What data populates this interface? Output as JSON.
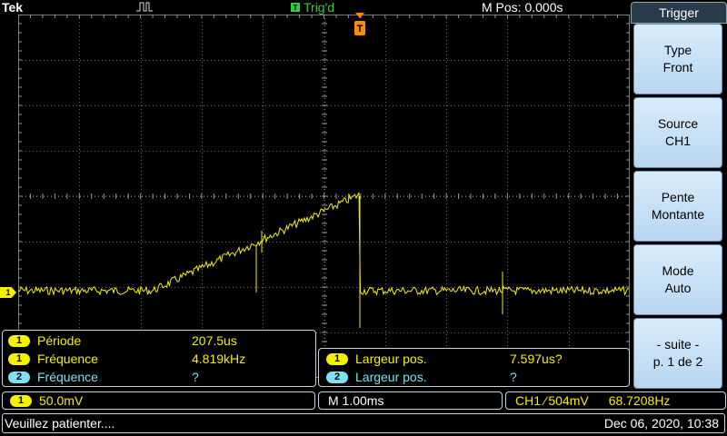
{
  "top": {
    "brand": "Tek",
    "trigger_state": "Trig'd",
    "position": "M Pos: 0.000s"
  },
  "menu": {
    "title": "Trigger",
    "buttons": [
      {
        "line1": "Type",
        "line2": "Front"
      },
      {
        "line1": "Source",
        "line2": "CH1"
      },
      {
        "line1": "Pente",
        "line2": "Montante"
      },
      {
        "line1": "Mode",
        "line2": "Auto"
      },
      {
        "line1": "- suite -",
        "line2": "p. 1 de 2"
      }
    ]
  },
  "measurements_left": [
    {
      "channel": "1",
      "label": "Période",
      "value": "207.5us"
    },
    {
      "channel": "1",
      "label": "Fréquence",
      "value": "4.819kHz"
    },
    {
      "channel": "2",
      "label": "Fréquence",
      "value": "?"
    }
  ],
  "measurements_right": [
    {
      "channel": "1",
      "label": "Largeur pos.",
      "value": "7.597us?"
    },
    {
      "channel": "2",
      "label": "Largeur pos.",
      "value": "?"
    }
  ],
  "status": {
    "ch1_channel": "1",
    "ch1_scale": "50.0mV",
    "timebase": "M 1.00ms",
    "trigger_source": "CH1",
    "trigger_slope": "⁄",
    "trigger_level": "504mV",
    "trigger_freq": "68.7208Hz",
    "message": "Veuillez patienter....",
    "datetime": "Dec 06, 2020, 10:38"
  },
  "markers": {
    "channel1": "1",
    "trigger": "T"
  },
  "colors": {
    "ch1": "#f5f000",
    "ch2": "#7ee0f0",
    "trigger": "#ff8c00",
    "trigd": "#2ecc40"
  }
}
